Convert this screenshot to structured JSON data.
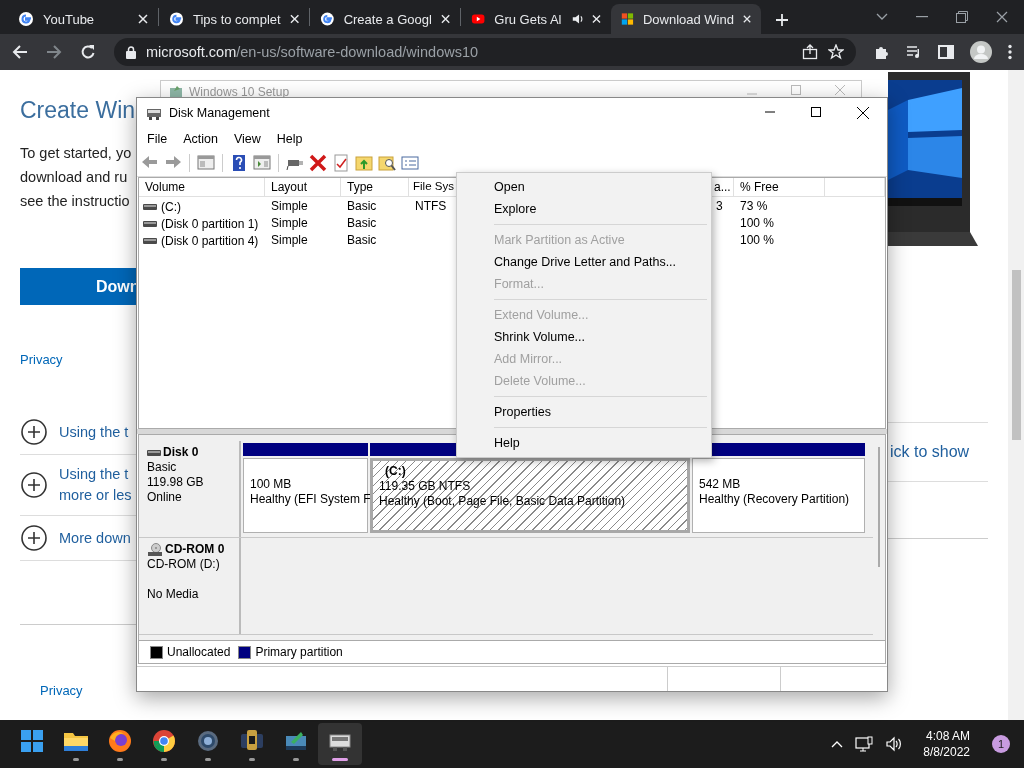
{
  "browser": {
    "tabs": [
      {
        "title": "YouTube",
        "kind": "google",
        "selected": false,
        "audio": false
      },
      {
        "title": "Tips to complet",
        "kind": "google",
        "selected": false,
        "audio": false
      },
      {
        "title": "Create a Googl",
        "kind": "google",
        "selected": false,
        "audio": false
      },
      {
        "title": "Gru Gets Al",
        "kind": "youtube",
        "selected": false,
        "audio": true
      },
      {
        "title": "Download Wind",
        "kind": "microsoft",
        "selected": true,
        "audio": false
      }
    ],
    "url": "**microsoft.com**/en-us/software-download/windows10"
  },
  "web_page": {
    "heading": "Create Win",
    "intro_lines": [
      "To get started, yo",
      "download and ru",
      "see the instructio"
    ],
    "download_button": "Down",
    "privacy_link": "Privacy",
    "accordion": [
      {
        "lines": [
          "Using the t"
        ]
      },
      {
        "lines": [
          "Using the t",
          "more or les"
        ]
      },
      {
        "lines": [
          "More down"
        ]
      }
    ],
    "right_text": "ick to show",
    "footer_privacy": "Privacy"
  },
  "background_window": {
    "title": "Windows 10 Setup"
  },
  "disk_management": {
    "title": "Disk Management",
    "menu": [
      "File",
      "Action",
      "View",
      "Help"
    ],
    "table": {
      "columns": [
        "Volume",
        "Layout",
        "Type",
        "File Sys",
        "a...",
        "% Free"
      ],
      "rows": [
        {
          "volume": "(C:)",
          "layout": "Simple",
          "type": "Basic",
          "file_system": "NTFS",
          "column_5": "3",
          "free": "73 %"
        },
        {
          "volume": "(Disk 0 partition 1)",
          "layout": "Simple",
          "type": "Basic",
          "free": "100 %"
        },
        {
          "volume": "(Disk 0 partition 4)",
          "layout": "Simple",
          "type": "Basic",
          "free": "100 %"
        }
      ]
    },
    "disks": [
      {
        "kind": "disk",
        "name": "Disk 0",
        "type": "Basic",
        "size": "119.98 GB",
        "status": "Online",
        "partitions": [
          {
            "size": "100 MB",
            "status": "Healthy (EFI System F",
            "kind": "primary",
            "selected": false
          },
          {
            "name": "(C:)",
            "size": "119.35 GB NTFS",
            "status": "Healthy (Boot, Page File, Basic Data Partition)",
            "kind": "primary",
            "selected": true
          },
          {
            "size": "542 MB",
            "status": "Healthy (Recovery Partition)",
            "kind": "primary",
            "selected": false
          }
        ]
      },
      {
        "kind": "cdrom",
        "name": "CD-ROM 0",
        "type": "CD-ROM (D:)",
        "status": "No Media"
      }
    ],
    "legend": [
      {
        "label": "Unallocated",
        "color": "#000000"
      },
      {
        "label": "Primary partition",
        "color": "#000080"
      }
    ]
  },
  "context_menu": {
    "items": [
      {
        "kind": "item",
        "label": "Open",
        "disabled": false
      },
      {
        "kind": "item",
        "label": "Explore",
        "disabled": false
      },
      {
        "kind": "separator"
      },
      {
        "kind": "item",
        "label": "Mark Partition as Active",
        "disabled": true
      },
      {
        "kind": "item",
        "label": "Change Drive Letter and Paths...",
        "disabled": false
      },
      {
        "kind": "item",
        "label": "Format...",
        "disabled": true
      },
      {
        "kind": "separator"
      },
      {
        "kind": "item",
        "label": "Extend Volume...",
        "disabled": true
      },
      {
        "kind": "item",
        "label": "Shrink Volume...",
        "disabled": false
      },
      {
        "kind": "item",
        "label": "Add Mirror...",
        "disabled": true
      },
      {
        "kind": "item",
        "label": "Delete Volume...",
        "disabled": true
      },
      {
        "kind": "separator"
      },
      {
        "kind": "item",
        "label": "Properties",
        "disabled": false
      },
      {
        "kind": "separator"
      },
      {
        "kind": "item",
        "label": "Help",
        "disabled": false
      }
    ]
  },
  "taskbar": {
    "apps": [
      {
        "kind": "start",
        "selected": false,
        "running": false
      },
      {
        "kind": "folder",
        "selected": false,
        "running": true
      },
      {
        "kind": "firefox",
        "selected": false,
        "running": true
      },
      {
        "kind": "chrome",
        "selected": false,
        "running": true
      },
      {
        "kind": "settings",
        "selected": false,
        "running": true
      },
      {
        "kind": "app",
        "selected": false,
        "running": true
      },
      {
        "kind": "installer",
        "selected": false,
        "running": true
      },
      {
        "kind": "drive",
        "selected": true,
        "running": true
      }
    ],
    "time": "4:08 AM",
    "date": "8/8/2022",
    "notification_count": "1"
  }
}
